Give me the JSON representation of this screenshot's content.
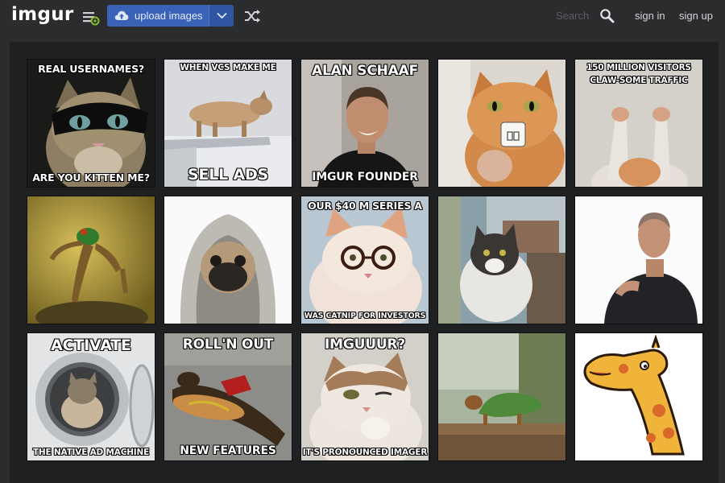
{
  "header": {
    "logo": "imgur",
    "upload_label": "upload images",
    "search_placeholder": "Search",
    "signin_label": "sign in",
    "signup_label": "sign up"
  },
  "icons": {
    "menu": "menu-icon",
    "upload": "cloud-upload-icon",
    "dropdown": "chevron-down-icon",
    "random": "shuffle-icon",
    "search": "search-icon"
  },
  "colors": {
    "header_bg": "#2b2c2e",
    "gallery_bg": "#1f2022",
    "accent": "#3a62b6",
    "text_muted": "#5c5e62"
  },
  "gallery": {
    "rows": [
      [
        {
          "top": "Real usernames?",
          "bottom": "Are you kitten me?"
        },
        {
          "top": "When VCs make me",
          "bottom": "Sell ads"
        },
        {
          "top": "Alan Schaaf",
          "bottom": "Imgur founder"
        },
        {
          "top": "",
          "bottom": ""
        },
        {
          "top": "150 million visitors",
          "top2": "claw-some traffic",
          "bottom": ""
        }
      ],
      [
        {
          "top": "",
          "bottom": ""
        },
        {
          "top": "",
          "bottom": ""
        },
        {
          "top": "Our $40 M series A",
          "bottom": "Was catnip for investors"
        },
        {
          "top": "",
          "bottom": ""
        },
        {
          "top": "",
          "bottom": ""
        }
      ],
      [
        {
          "top": "Activate",
          "bottom": "The native ad machine"
        },
        {
          "top": "Roll'n out",
          "bottom": "New features"
        },
        {
          "top": "Imguuur?",
          "bottom": "It's pronounced imager"
        },
        {
          "top": "",
          "bottom": ""
        },
        {
          "top": "",
          "bottom": ""
        }
      ]
    ]
  }
}
